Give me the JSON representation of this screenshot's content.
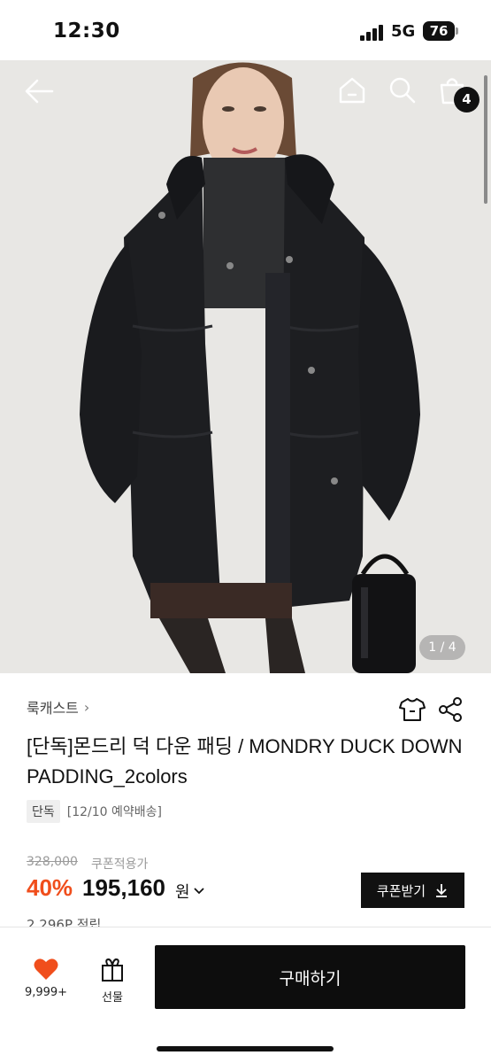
{
  "status_bar": {
    "time": "12:30",
    "network": "5G",
    "battery": "76"
  },
  "header": {
    "cart_count": "4"
  },
  "gallery": {
    "indicator": "1 / 4"
  },
  "product": {
    "brand": "룩캐스트",
    "title": "[단독]몬드리 덕 다운 패딩 / MONDRY DUCK DOWN PADDING_2colors",
    "badge": "단독",
    "shipping_note": "[12/10 예약배송]",
    "original_price": "328,000",
    "coupon_price_label": "쿠폰적용가",
    "discount": "40%",
    "price": "195,160",
    "currency": "원",
    "coupon_button": "쿠폰받기",
    "points": "2,296P 적립"
  },
  "bottom_bar": {
    "likes": "9,999+",
    "gift_label": "선물",
    "buy_label": "구매하기"
  },
  "colors": {
    "discount": "#f04e1c",
    "primary_button": "#111111",
    "heart": "#f04e1c"
  }
}
